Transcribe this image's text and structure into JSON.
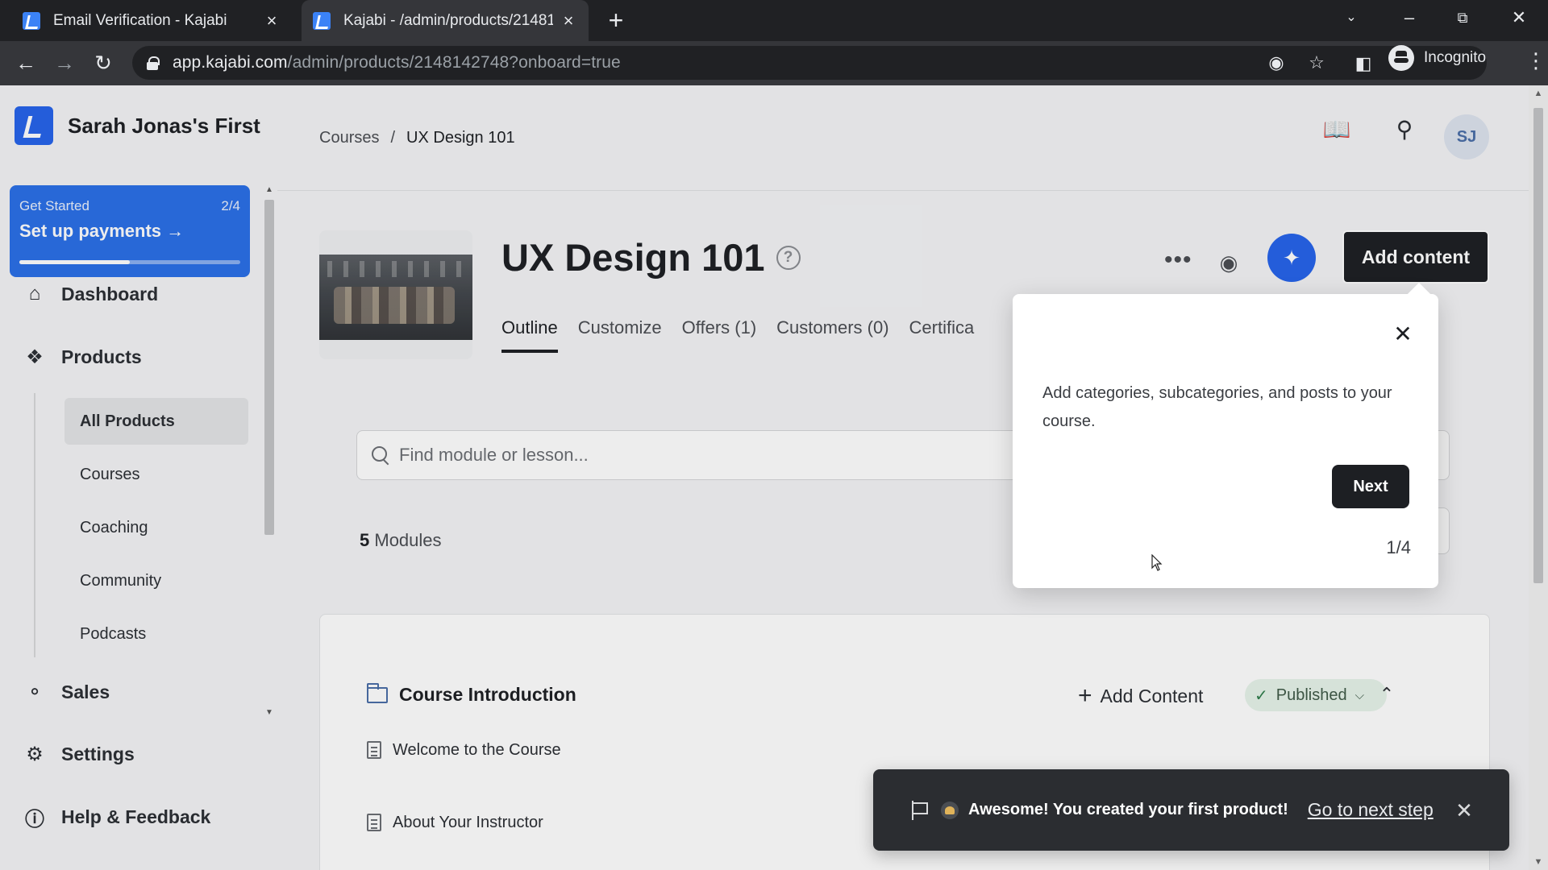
{
  "browser": {
    "tabs": [
      {
        "title": "Email Verification - Kajabi"
      },
      {
        "title": "Kajabi - /admin/products/2148142748"
      }
    ],
    "url_host": "app.kajabi.com",
    "url_path": "/admin/products/2148142748?onboard=true",
    "incognito_label": "Incognito"
  },
  "sidebar": {
    "site_name": "Sarah Jonas's First",
    "get_started": {
      "label": "Get Started",
      "progress_text": "2/4",
      "action": "Set up payments",
      "progress": 0.5
    },
    "nav": {
      "dashboard": "Dashboard",
      "products": "Products",
      "sales": "Sales",
      "settings": "Settings",
      "help": "Help & Feedback"
    },
    "product_sub": [
      "All Products",
      "Courses",
      "Coaching",
      "Community",
      "Podcasts"
    ]
  },
  "header": {
    "breadcrumb": [
      "Courses",
      "UX Design 101"
    ],
    "avatar_initials": "SJ"
  },
  "course": {
    "title": "UX Design 101",
    "tabs": [
      "Outline",
      "Customize",
      "Offers (1)",
      "Customers (0)",
      "Certifica"
    ],
    "add_content_label": "Add content",
    "search_placeholder": "Find module or lesson...",
    "modules_count": "5",
    "modules_label": "Modules",
    "module": {
      "title": "Course Introduction",
      "add_label": "Add Content",
      "status": "Published",
      "lessons": [
        "Welcome to the Course",
        "About Your Instructor"
      ]
    }
  },
  "popover": {
    "text": "Add categories, subcategories, and posts to your course.",
    "next_label": "Next",
    "step": "1/4"
  },
  "toast": {
    "message": "Awesome! You created your first product!",
    "link": "Go to next step"
  },
  "colors": {
    "brand_blue": "#2563eb",
    "dark_button": "#1d1f23",
    "published_bg": "#e6f3ea",
    "toast_bg": "#2b2d31"
  }
}
